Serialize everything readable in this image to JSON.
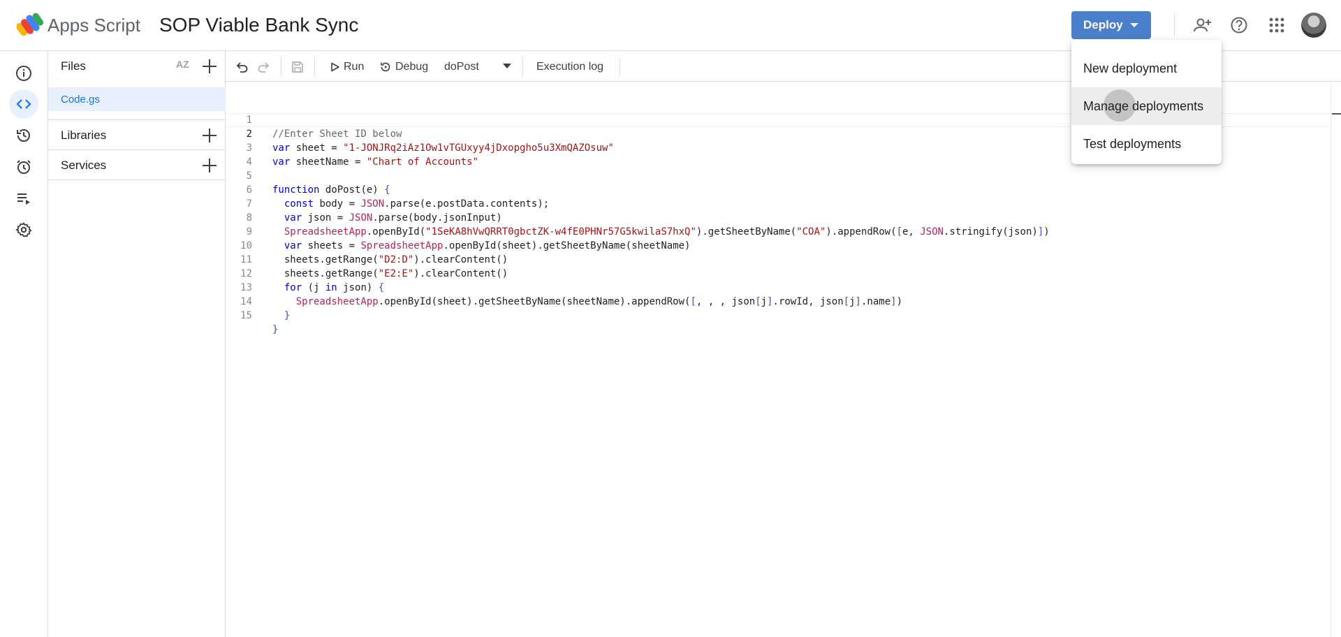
{
  "header": {
    "app_name": "Apps Script",
    "project_title": "SOP Viable Bank Sync",
    "deploy_label": "Deploy",
    "icons": [
      "add-person-icon",
      "help-icon",
      "apps-grid-icon"
    ]
  },
  "left_rail": {
    "items": [
      "info-icon",
      "code-icon",
      "history-icon",
      "alarm-icon",
      "executions-icon",
      "settings-icon"
    ],
    "active": "code-icon"
  },
  "files_panel": {
    "title": "Files",
    "sort_icon": "AZ",
    "files": [
      {
        "name": "Code.gs",
        "selected": true
      }
    ],
    "sections": [
      {
        "label": "Libraries"
      },
      {
        "label": "Services"
      }
    ]
  },
  "toolbar": {
    "run_label": "Run",
    "debug_label": "Debug",
    "function_name": "doPost",
    "execution_log_label": "Execution log"
  },
  "editor": {
    "active_line": 2,
    "line_numbers": [
      "1",
      "2",
      "3",
      "4",
      "5",
      "6",
      "7",
      "8",
      "9",
      "10",
      "11",
      "12",
      "13",
      "14",
      "15"
    ],
    "lines": [
      "//Enter Sheet ID below",
      "var sheet = \"1-JONJRq2iAz1Ow1vTGUxyy4jDxopgho5u3XmQAZOsuw\"",
      "var sheetName = \"Chart of Accounts\"",
      "",
      "function doPost(e) {",
      "  const body = JSON.parse(e.postData.contents);",
      "  var json = JSON.parse(body.jsonInput)",
      "  SpreadsheetApp.openById(\"1SeKA8hVwQRRT0gbctZK-w4fE0PHNr57G5kwilaS7hxQ\").getSheetByName(\"COA\").appendRow([e, JSON.stringify(json)])",
      "  var sheets = SpreadsheetApp.openById(sheet).getSheetByName(sheetName)",
      "  sheets.getRange(\"D2:D\").clearContent()",
      "  sheets.getRange(\"E2:E\").clearContent()",
      "  for (j in json) {",
      "    SpreadsheetApp.openById(sheet).getSheetByName(sheetName).appendRow([, , , json[j].rowId, json[j].name])",
      "  }",
      "}"
    ]
  },
  "deploy_menu": {
    "items": [
      {
        "label": "New deployment"
      },
      {
        "label": "Manage deployments",
        "hovered": true
      },
      {
        "label": "Test deployments"
      }
    ]
  },
  "colors": {
    "accent": "#1a73e8",
    "deploy_button": "#4a7fcb",
    "selected_bg": "#e8f0fe",
    "string": "#a31515",
    "keyword": "#0000cc",
    "class_name": "#b5235d"
  }
}
